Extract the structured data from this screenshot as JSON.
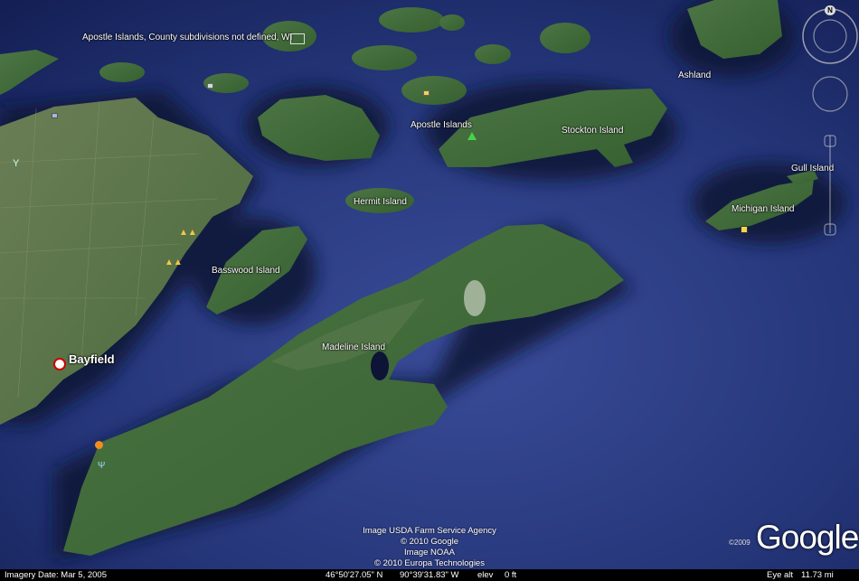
{
  "map": {
    "top_notice": "Apostle Islands, County subdivisions not defined, WI",
    "labels": {
      "ashland": "Ashland",
      "apostle_islands": "Apostle Islands",
      "stockton_island": "Stockton Island",
      "gull_island": "Gull Island",
      "michigan_island": "Michigan Island",
      "hermit_island": "Hermit Island",
      "basswood_island": "Basswood Island",
      "madeline_island": "Madeline Island",
      "bayfield": "Bayfield"
    }
  },
  "credits": {
    "line1": "Image USDA Farm Service Agency",
    "line2": "© 2010 Google",
    "line3": "Image NOAA",
    "line4": "© 2010 Europa Technologies"
  },
  "logo": {
    "year": "©2009",
    "text": "Google"
  },
  "nav": {
    "north": "N"
  },
  "status_bar": {
    "imagery_date": "Imagery Date: Mar  5, 2005",
    "latitude": "46°50'27.05\" N",
    "longitude": "90°39'31.83\" W",
    "elev_label": "elev",
    "elev_value": "0 ft",
    "eye_alt_label": "Eye alt",
    "eye_alt_value": "11.73 mi"
  },
  "colors": {
    "water_deep": "#1a2868",
    "water_shallow": "#2b3f86",
    "land": "#3f6b3a",
    "land_light": "#5b7a4c"
  }
}
